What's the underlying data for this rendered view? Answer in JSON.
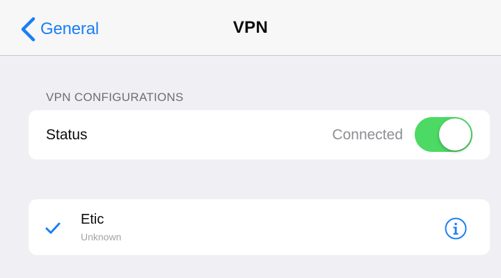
{
  "nav": {
    "back_label": "General",
    "title": "VPN",
    "back_icon": "chevron-left-icon"
  },
  "section": {
    "header": "VPN CONFIGURATIONS"
  },
  "status_row": {
    "label": "Status",
    "value": "Connected",
    "toggle_on": true
  },
  "vpn_list": [
    {
      "name": "Etic",
      "subtitle": "Unknown",
      "selected": true,
      "check_icon": "checkmark-icon",
      "info_icon": "info-icon"
    }
  ],
  "colors": {
    "accent": "#1a7ef5",
    "toggle_on": "#4cd964",
    "background": "#efeff4"
  }
}
